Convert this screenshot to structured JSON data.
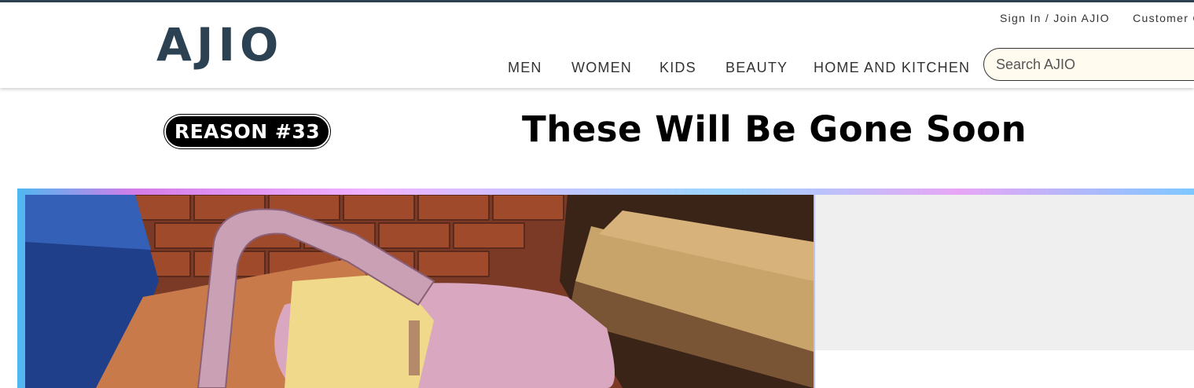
{
  "header": {
    "logo_text": "AJIO",
    "utility": {
      "sign_in": "Sign In / Join AJIO",
      "customer_care": "Customer C"
    },
    "nav": [
      {
        "label": "MEN"
      },
      {
        "label": "WOMEN"
      },
      {
        "label": "KIDS"
      },
      {
        "label": "BEAUTY"
      },
      {
        "label": "HOME AND KITCHEN"
      }
    ],
    "search": {
      "placeholder": "Search AJIO",
      "value": ""
    }
  },
  "promo": {
    "badge_text": "REASON #33",
    "headline": "These Will Be Gone Soon"
  },
  "colors": {
    "brand": "#2c4152",
    "search_bg": "#fffcef",
    "side_panel": "#efefef"
  }
}
